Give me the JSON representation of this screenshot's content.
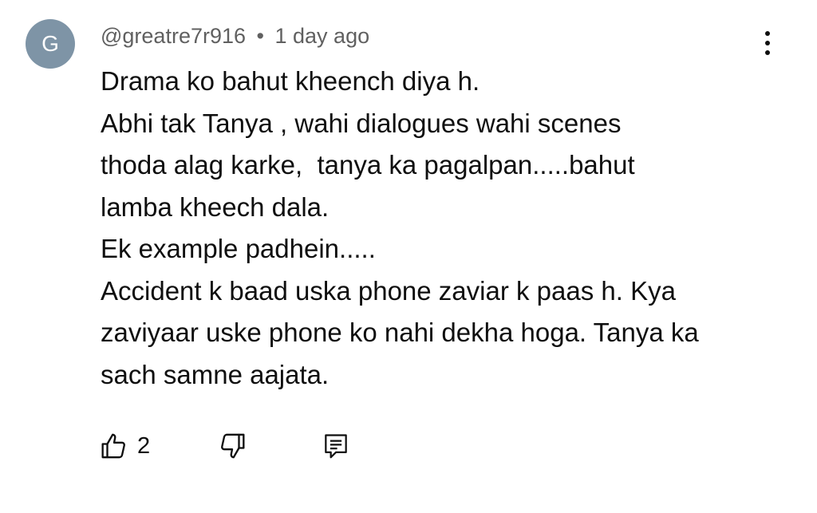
{
  "comment": {
    "avatar_letter": "G",
    "author": "@greatre7r916",
    "separator": "•",
    "time": "1 day ago",
    "lines": [
      "Drama ko bahut kheench diya h.",
      "Abhi tak Tanya , wahi dialogues wahi scenes",
      "thoda alag karke,  tanya ka pagalpan.....bahut",
      "lamba kheech dala.",
      "Ek example padhein.....",
      "Accident k baad uska phone zaviar k paas h. Kya",
      "zaviyaar uske phone ko nahi dekha hoga. Tanya ka",
      "sach samne aajata."
    ],
    "like_count": "2"
  },
  "icons": {
    "menu": "more-vert-icon",
    "like": "thumb-up-icon",
    "dislike": "thumb-down-icon",
    "reply": "comment-reply-icon"
  },
  "colors": {
    "avatar_bg": "#7e94a6",
    "meta_text": "#606060",
    "body_text": "#0f0f0f"
  }
}
